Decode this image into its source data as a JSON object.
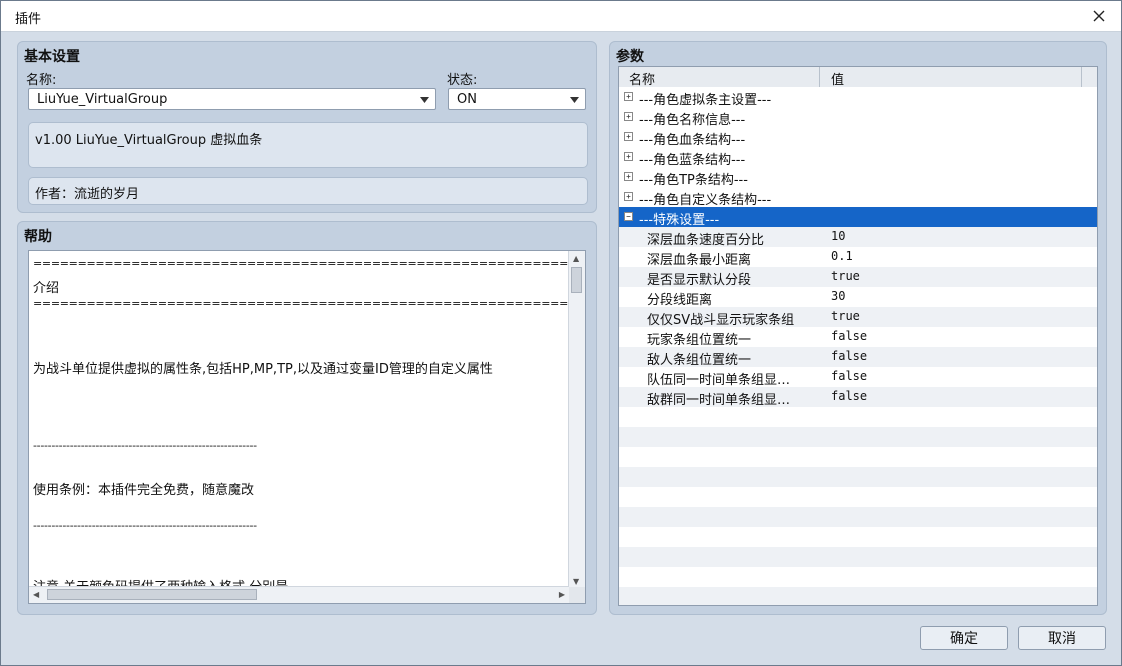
{
  "window": {
    "title": "插件"
  },
  "basic": {
    "section_title": "基本设置",
    "name_label": "名称:",
    "name_value": "LiuYue_VirtualGroup",
    "status_label": "状态:",
    "status_value": "ON",
    "description": "v1.00 LiuYue_VirtualGroup 虚拟血条",
    "author": "作者：流逝的岁月"
  },
  "help": {
    "section_title": "帮助",
    "lines": [
      "===========================================================================",
      "介绍",
      "===========================================================================",
      "为战斗单位提供虚拟的属性条,包括HP,MP,TP,以及通过变量ID管理的自定义属性",
      "-------------------------------------------------------------",
      "使用条例：本插件完全免费，随意魔改",
      "-------------------------------------------------------------",
      "注意 关于颜色码提供了两种输入格式 分别是"
    ]
  },
  "params": {
    "section_title": "参数",
    "col_name": "名称",
    "col_value": "值",
    "groups": [
      {
        "label": "---角色虚拟条主设置---"
      },
      {
        "label": "---角色名称信息---"
      },
      {
        "label": "---角色血条结构---"
      },
      {
        "label": "---角色蓝条结构---"
      },
      {
        "label": "---角色TP条结构---"
      },
      {
        "label": "---角色自定义条结构---"
      },
      {
        "label": "---特殊设置---"
      }
    ],
    "items": [
      {
        "name": "深层血条速度百分比",
        "value": "10"
      },
      {
        "name": "深层血条最小距离",
        "value": "0.1"
      },
      {
        "name": "是否显示默认分段",
        "value": "true"
      },
      {
        "name": "分段线距离",
        "value": "30"
      },
      {
        "name": "仅仅SV战斗显示玩家条组",
        "value": "true"
      },
      {
        "name": "玩家条组位置统一",
        "value": "false"
      },
      {
        "name": "敌人条组位置统一",
        "value": "false"
      },
      {
        "name": "队伍同一时间单条组显…",
        "value": "false"
      },
      {
        "name": "敌群同一时间单条组显…",
        "value": "false"
      }
    ]
  },
  "buttons": {
    "ok": "确定",
    "cancel": "取消"
  }
}
